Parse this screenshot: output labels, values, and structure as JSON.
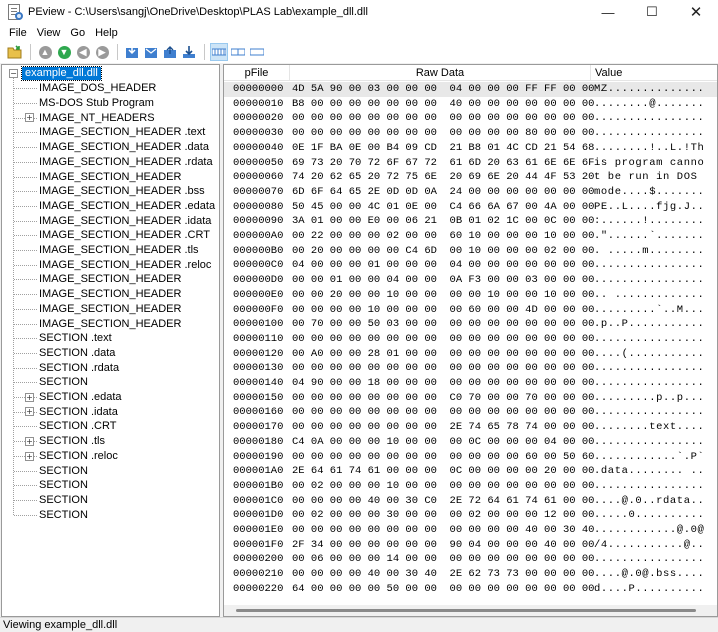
{
  "window": {
    "title": "PEview - C:\\Users\\sangj\\OneDrive\\Desktop\\PLAS Lab\\example_dll.dll",
    "buttons": {
      "minimize": "—",
      "maximize": "☐",
      "close": "✕"
    }
  },
  "menu": [
    "File",
    "View",
    "Go",
    "Help"
  ],
  "toolbar": {
    "icons": [
      "open-file-icon",
      "up-icon",
      "forward-icon",
      "back-icon",
      "next-icon",
      "save-section-icon",
      "send-icon",
      "export-icon",
      "download-icon",
      "view-bytes-icon",
      "view-words-icon",
      "view-dwords-icon"
    ]
  },
  "tree": {
    "root": "example_dll.dll",
    "items": [
      {
        "label": "IMAGE_DOS_HEADER",
        "expandable": false
      },
      {
        "label": "MS-DOS Stub Program",
        "expandable": false
      },
      {
        "label": "IMAGE_NT_HEADERS",
        "expandable": true
      },
      {
        "label": "IMAGE_SECTION_HEADER .text",
        "expandable": false
      },
      {
        "label": "IMAGE_SECTION_HEADER .data",
        "expandable": false
      },
      {
        "label": "IMAGE_SECTION_HEADER .rdata",
        "expandable": false
      },
      {
        "label": "IMAGE_SECTION_HEADER",
        "expandable": false
      },
      {
        "label": "IMAGE_SECTION_HEADER .bss",
        "expandable": false
      },
      {
        "label": "IMAGE_SECTION_HEADER .edata",
        "expandable": false
      },
      {
        "label": "IMAGE_SECTION_HEADER .idata",
        "expandable": false
      },
      {
        "label": "IMAGE_SECTION_HEADER .CRT",
        "expandable": false
      },
      {
        "label": "IMAGE_SECTION_HEADER .tls",
        "expandable": false
      },
      {
        "label": "IMAGE_SECTION_HEADER .reloc",
        "expandable": false
      },
      {
        "label": "IMAGE_SECTION_HEADER",
        "expandable": false
      },
      {
        "label": "IMAGE_SECTION_HEADER",
        "expandable": false
      },
      {
        "label": "IMAGE_SECTION_HEADER",
        "expandable": false
      },
      {
        "label": "IMAGE_SECTION_HEADER",
        "expandable": false
      },
      {
        "label": "SECTION .text",
        "expandable": false
      },
      {
        "label": "SECTION .data",
        "expandable": false
      },
      {
        "label": "SECTION .rdata",
        "expandable": false
      },
      {
        "label": "SECTION",
        "expandable": false
      },
      {
        "label": "SECTION .edata",
        "expandable": true
      },
      {
        "label": "SECTION .idata",
        "expandable": true
      },
      {
        "label": "SECTION .CRT",
        "expandable": false
      },
      {
        "label": "SECTION .tls",
        "expandable": true
      },
      {
        "label": "SECTION .reloc",
        "expandable": true
      },
      {
        "label": "SECTION",
        "expandable": false
      },
      {
        "label": "SECTION",
        "expandable": false
      },
      {
        "label": "SECTION",
        "expandable": false
      },
      {
        "label": "SECTION",
        "expandable": false
      }
    ]
  },
  "list": {
    "columns": [
      "pFile",
      "Raw Data",
      "Value"
    ],
    "rows": [
      {
        "pfile": "00000000",
        "raw": "4D 5A 90 00 03 00 00 00  04 00 00 00 FF FF 00 00",
        "value": "MZ.............."
      },
      {
        "pfile": "00000010",
        "raw": "B8 00 00 00 00 00 00 00  40 00 00 00 00 00 00 00",
        "value": "........@......."
      },
      {
        "pfile": "00000020",
        "raw": "00 00 00 00 00 00 00 00  00 00 00 00 00 00 00 00",
        "value": "................"
      },
      {
        "pfile": "00000030",
        "raw": "00 00 00 00 00 00 00 00  00 00 00 00 80 00 00 00",
        "value": "................"
      },
      {
        "pfile": "00000040",
        "raw": "0E 1F BA 0E 00 B4 09 CD  21 B8 01 4C CD 21 54 68",
        "value": "........!..L.!Th"
      },
      {
        "pfile": "00000050",
        "raw": "69 73 20 70 72 6F 67 72  61 6D 20 63 61 6E 6E 6F",
        "value": "is program canno"
      },
      {
        "pfile": "00000060",
        "raw": "74 20 62 65 20 72 75 6E  20 69 6E 20 44 4F 53 20",
        "value": "t be run in DOS "
      },
      {
        "pfile": "00000070",
        "raw": "6D 6F 64 65 2E 0D 0D 0A  24 00 00 00 00 00 00 00",
        "value": "mode....$......."
      },
      {
        "pfile": "00000080",
        "raw": "50 45 00 00 4C 01 0E 00  C4 66 6A 67 00 4A 00 00",
        "value": "PE..L....fjg.J.."
      },
      {
        "pfile": "00000090",
        "raw": "3A 01 00 00 E0 00 06 21  0B 01 02 1C 00 0C 00 00",
        "value": ":......!........"
      },
      {
        "pfile": "000000A0",
        "raw": "00 22 00 00 00 02 00 00  60 10 00 00 00 10 00 00",
        "value": ".\"......`......."
      },
      {
        "pfile": "000000B0",
        "raw": "00 20 00 00 00 00 C4 6D  00 10 00 00 00 02 00 00",
        "value": ". .....m........"
      },
      {
        "pfile": "000000C0",
        "raw": "04 00 00 00 01 00 00 00  04 00 00 00 00 00 00 00",
        "value": "................"
      },
      {
        "pfile": "000000D0",
        "raw": "00 00 01 00 00 04 00 00  0A F3 00 00 03 00 00 00",
        "value": "................"
      },
      {
        "pfile": "000000E0",
        "raw": "00 00 20 00 00 10 00 00  00 00 10 00 00 10 00 00",
        "value": ".. ............."
      },
      {
        "pfile": "000000F0",
        "raw": "00 00 00 00 10 00 00 00  00 60 00 00 4D 00 00 00",
        "value": ".........`..M..."
      },
      {
        "pfile": "00000100",
        "raw": "00 70 00 00 50 03 00 00  00 00 00 00 00 00 00 00",
        "value": ".p..P..........."
      },
      {
        "pfile": "00000110",
        "raw": "00 00 00 00 00 00 00 00  00 00 00 00 00 00 00 00",
        "value": "................"
      },
      {
        "pfile": "00000120",
        "raw": "00 A0 00 00 28 01 00 00  00 00 00 00 00 00 00 00",
        "value": "....(..........."
      },
      {
        "pfile": "00000130",
        "raw": "00 00 00 00 00 00 00 00  00 00 00 00 00 00 00 00",
        "value": "................"
      },
      {
        "pfile": "00000140",
        "raw": "04 90 00 00 18 00 00 00  00 00 00 00 00 00 00 00",
        "value": "................"
      },
      {
        "pfile": "00000150",
        "raw": "00 00 00 00 00 00 00 00  C0 70 00 00 70 00 00 00",
        "value": ".........p..p..."
      },
      {
        "pfile": "00000160",
        "raw": "00 00 00 00 00 00 00 00  00 00 00 00 00 00 00 00",
        "value": "................"
      },
      {
        "pfile": "00000170",
        "raw": "00 00 00 00 00 00 00 00  2E 74 65 78 74 00 00 00",
        "value": "........text...."
      },
      {
        "pfile": "00000180",
        "raw": "C4 0A 00 00 00 10 00 00  00 0C 00 00 00 04 00 00",
        "value": "................"
      },
      {
        "pfile": "00000190",
        "raw": "00 00 00 00 00 00 00 00  00 00 00 00 60 00 50 60",
        "value": "............`.P`"
      },
      {
        "pfile": "000001A0",
        "raw": "2E 64 61 74 61 00 00 00  0C 00 00 00 00 20 00 00",
        "value": ".data........ .."
      },
      {
        "pfile": "000001B0",
        "raw": "00 02 00 00 00 10 00 00  00 00 00 00 00 00 00 00",
        "value": "................"
      },
      {
        "pfile": "000001C0",
        "raw": "00 00 00 00 40 00 30 C0  2E 72 64 61 74 61 00 00",
        "value": "....@.0..rdata.."
      },
      {
        "pfile": "000001D0",
        "raw": "00 02 00 00 00 30 00 00  00 02 00 00 00 12 00 00",
        "value": ".....0.........."
      },
      {
        "pfile": "000001E0",
        "raw": "00 00 00 00 00 00 00 00  00 00 00 00 40 00 30 40",
        "value": "............@.0@"
      },
      {
        "pfile": "000001F0",
        "raw": "2F 34 00 00 00 00 00 00  90 04 00 00 00 40 00 00",
        "value": "/4...........@.."
      },
      {
        "pfile": "00000200",
        "raw": "00 06 00 00 00 14 00 00  00 00 00 00 00 00 00 00",
        "value": "................"
      },
      {
        "pfile": "00000210",
        "raw": "00 00 00 00 40 00 30 40  2E 62 73 73 00 00 00 00",
        "value": "....@.0@.bss...."
      },
      {
        "pfile": "00000220",
        "raw": "64 00 00 00 00 50 00 00  00 00 00 00 00 00 00 00",
        "value": "d....P.........."
      }
    ]
  },
  "status": "Viewing example_dll.dll"
}
